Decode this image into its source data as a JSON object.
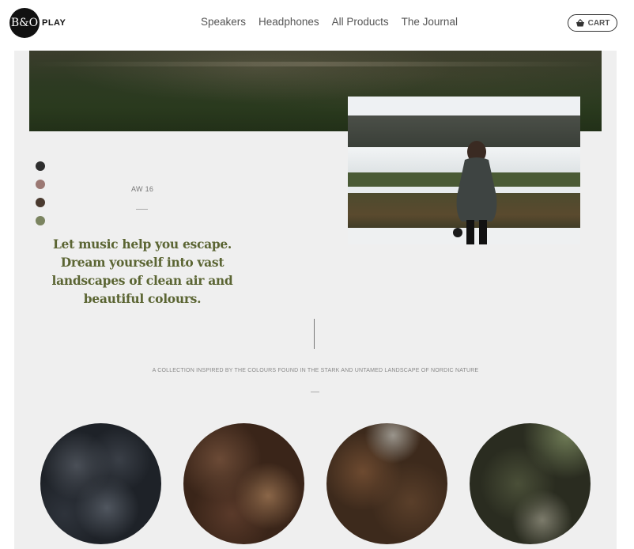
{
  "brand": {
    "logo_text": "B&O",
    "logo_suffix": "PLAY"
  },
  "nav": {
    "items": [
      {
        "label": "Speakers"
      },
      {
        "label": "Headphones"
      },
      {
        "label": "All Products"
      },
      {
        "label": "The Journal"
      }
    ]
  },
  "cart": {
    "label": "CART",
    "icon": "basket-icon"
  },
  "swatches": [
    {
      "color": "#2e2e2e"
    },
    {
      "color": "#9b7873"
    },
    {
      "color": "#4a3a2f"
    },
    {
      "color": "#7b8460"
    }
  ],
  "collection": {
    "season": "AW 16",
    "headline": "Let music help you escape. Dream yourself into vast landscapes of clean air and beautiful colours.",
    "tagline": "A COLLECTION INSPIRED BY THE COLOURS FOUND IN THE STARK AND UNTAMED LANDSCAPE OF NORDIC NATURE"
  },
  "colors": {
    "accent_headline": "#5b6533",
    "panel_bg": "#efefef"
  }
}
